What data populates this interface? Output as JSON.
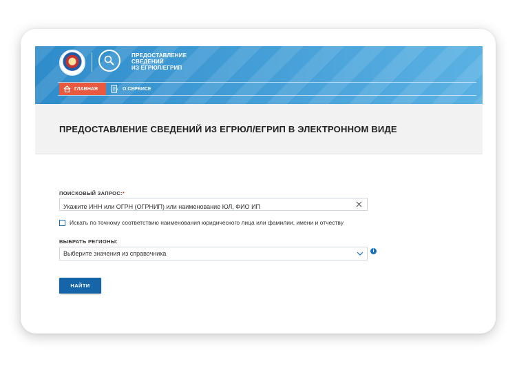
{
  "header": {
    "service_title_lines": [
      "ПРЕДОСТАВЛЕНИЕ",
      "СВЕДЕНИЙ",
      "ИЗ ЕГРЮЛ/ЕГРИП"
    ],
    "emblem_icon": "fns-emblem-icon",
    "service_icon": "search-service-icon"
  },
  "nav": {
    "home_label": "ГЛАВНАЯ",
    "home_icon": "home-icon",
    "about_label": "О СЕРВИСЕ",
    "about_icon": "document-icon",
    "home_color": "#e8593f"
  },
  "page": {
    "title": "ПРЕДОСТАВЛЕНИЕ СВЕДЕНИЙ ИЗ ЕГРЮЛ/ЕГРИП В ЭЛЕКТРОННОМ ВИДЕ"
  },
  "form": {
    "query_label": "ПОИСКОВЫЙ ЗАПРОС:",
    "required_mark": "*",
    "query_placeholder": "Укажите ИНН или ОГРН (ОГРНИП) или наименование ЮЛ, ФИО ИП",
    "query_value": "",
    "exact_match_label": "Искать по точному соответствию наименования юридического лица или фамилии, имени и отчеству",
    "exact_match_checked": false,
    "region_label": "ВЫБРАТЬ РЕГИОНЫ:",
    "region_placeholder": "Выберите значения из справочника",
    "submit_label": "НАЙТИ",
    "accent_color": "#1565a8"
  }
}
